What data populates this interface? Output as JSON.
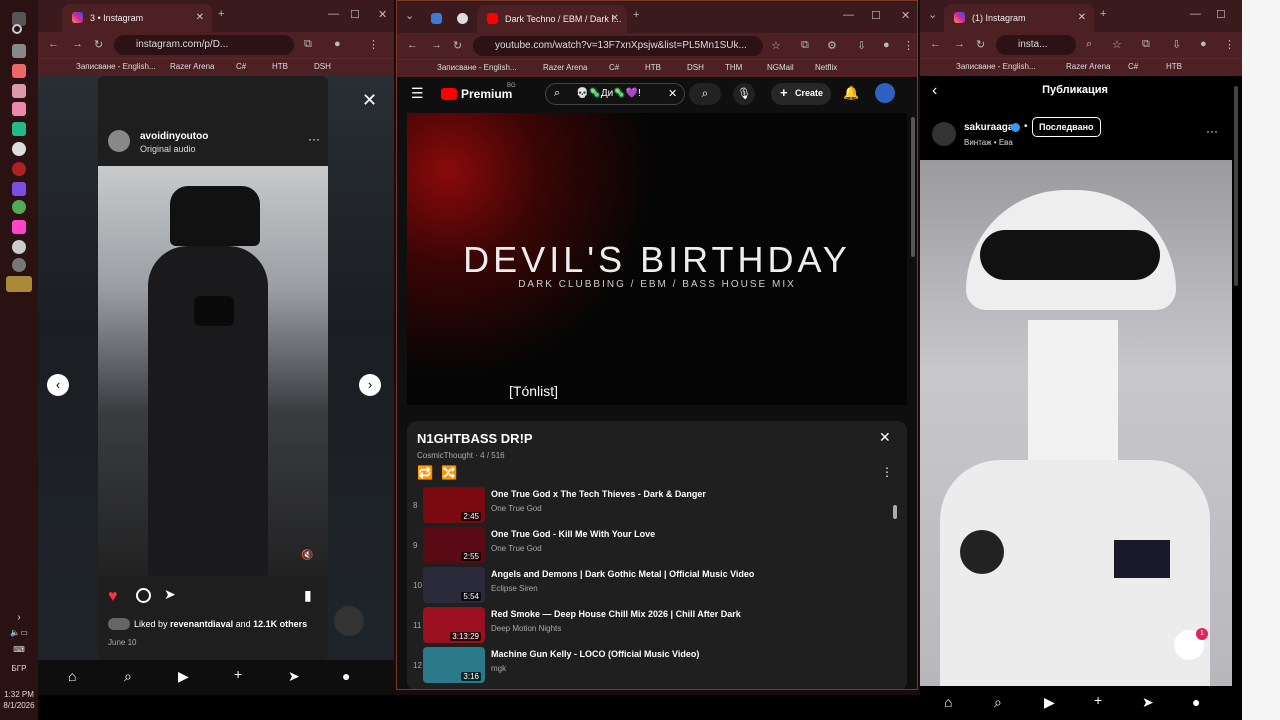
{
  "taskbar": {
    "time": "1:32 PM",
    "date": "8/1/2026",
    "lang": "БГР"
  },
  "left": {
    "tab_title": "3 • Instagram",
    "url": "instagram.com/p/D...",
    "bookmarks": [
      "Записване - English...",
      "Razer Arena",
      "C#",
      "НТВ",
      "DSH"
    ],
    "username": "avoidinyoutoo",
    "audio": "Original audio",
    "liked_by_prefix": "Liked by",
    "liked_by_user": "revenantdiaval",
    "liked_by_and": "and",
    "liked_by_others": "12.1K others",
    "date": "June 10",
    "icons": {
      "close": "close-icon",
      "prev": "chevron-left-icon",
      "next": "chevron-right-icon",
      "like": "heart-icon",
      "comment": "comment-icon",
      "share": "send-icon",
      "save": "bookmark-icon",
      "mute": "mute-icon"
    }
  },
  "mid": {
    "tab_title": "Dark Techno / EBM / Dark I...",
    "url": "youtube.com/watch?v=13F7xnXpsjw&list=PL5Mn1SUk...",
    "bookmarks": [
      "Записване - English...",
      "Razer Arena",
      "C#",
      "НТВ",
      "DSH",
      "THM",
      "NGMail",
      "Netflix"
    ],
    "logo": "Premium",
    "logo_sup": "BG",
    "search_value": "💀🦠Ди🦠💜!",
    "create_label": "Create",
    "video_title": "DEVIL'S BIRTHDAY",
    "video_subtitle": "DARK CLUBBING / EBM / BASS HOUSE MIX",
    "caption": "[Tónlist]",
    "playlist": {
      "name": "N1GHTBASS DR!P",
      "owner": "CosmicThought",
      "position": "4 / 516",
      "items": [
        {
          "num": "8",
          "title": "One True God x The Tech Thieves - Dark & Danger",
          "channel": "One True God",
          "duration": "2:45",
          "color": "#7a0a10"
        },
        {
          "num": "9",
          "title": "One True God - Kill Me With Your Love",
          "channel": "One True God",
          "duration": "2:55",
          "color": "#5a0a14"
        },
        {
          "num": "10",
          "title": "Angels and Demons | Dark Gothic Metal | Official Music Video",
          "channel": "Eclipse Siren",
          "duration": "5:54",
          "color": "#2a2a3a"
        },
        {
          "num": "11",
          "title": "Red Smoke — Deep House Chill Mix 2026 | Chill After Dark",
          "channel": "Deep Motion Nights",
          "duration": "3:13:29",
          "color": "#9a1020"
        },
        {
          "num": "12",
          "title": "Machine Gun Kelly - LOCO (Official Music Video)",
          "channel": "mgk",
          "duration": "3:16",
          "color": "#2a7a8a"
        }
      ]
    }
  },
  "right": {
    "tab_title": "(1) Instagram",
    "url": "insta...",
    "bookmarks": [
      "Записване - English...",
      "Razer Arena",
      "C#",
      "НТВ"
    ],
    "page_title": "Публикация",
    "username": "sakuraaga",
    "follow_label": "Последвано",
    "subline": "Винтаж • Ева",
    "badge": "1"
  }
}
